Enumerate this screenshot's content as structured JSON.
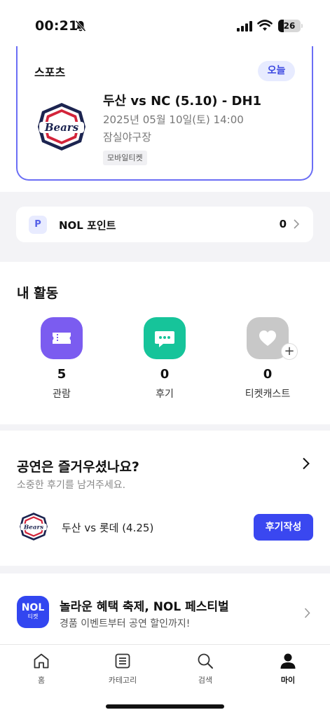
{
  "status_bar": {
    "time": "00:21",
    "battery": "26"
  },
  "ticket": {
    "category": "스포츠",
    "today_badge": "오늘",
    "title": "두산 vs NC (5.10) - DH1",
    "datetime": "2025년 05월 10일(토) 14:00",
    "venue": "잠실야구장",
    "ticket_type": "모바일티켓",
    "team_logo_text": "Bears"
  },
  "points": {
    "badge": "P",
    "label": "NOL 포인트",
    "value": "0"
  },
  "activity": {
    "title": "내 활동",
    "items": [
      {
        "count": "5",
        "label": "관람",
        "icon": "ticket-icon",
        "color": "#7b5cf0"
      },
      {
        "count": "0",
        "label": "후기",
        "icon": "chat-icon",
        "color": "#16c49a"
      },
      {
        "count": "0",
        "label": "티켓캐스트",
        "icon": "heart-icon",
        "color": "#c8c8c8"
      }
    ]
  },
  "review": {
    "title": "공연은 즐거우셨나요?",
    "subtitle": "소중한 후기를 남겨주세요.",
    "game": "두산 vs 롯데 (4.25)",
    "button": "후기작성"
  },
  "banner": {
    "logo_top": "NOL",
    "logo_bottom": "티켓",
    "title": "놀라운 혜택 축제, NOL 페스티벌",
    "subtitle": "경품 이벤트부터 공연 할인까지!"
  },
  "tabs": [
    {
      "label": "홈",
      "icon": "home-icon"
    },
    {
      "label": "카테고리",
      "icon": "list-icon"
    },
    {
      "label": "검색",
      "icon": "search-icon"
    },
    {
      "label": "마이",
      "icon": "person-icon",
      "active": true
    }
  ],
  "colors": {
    "accent": "#3a47f0",
    "card_border": "#6b6ef5"
  }
}
